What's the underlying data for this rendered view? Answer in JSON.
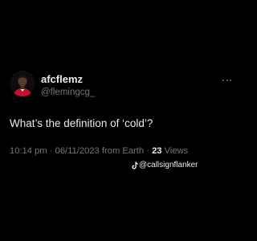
{
  "tweet": {
    "display_name": "afcflemz",
    "handle": "@flemingcg_",
    "text": "What’s the definition of ‘cold’?",
    "time": "10:14 pm",
    "date": "06/11/2023",
    "location": "from Earth",
    "separator": "·",
    "views_count": "23",
    "views_label": "Views"
  },
  "icons": {
    "avatar": "profile-avatar",
    "more": "more-horizontal-icon",
    "watermark": "tiktok-icon"
  },
  "watermark": {
    "text": "@callsignflanker"
  },
  "colors": {
    "background": "#000000",
    "primary_text": "#e7e9ea",
    "secondary_text": "#71767b"
  }
}
